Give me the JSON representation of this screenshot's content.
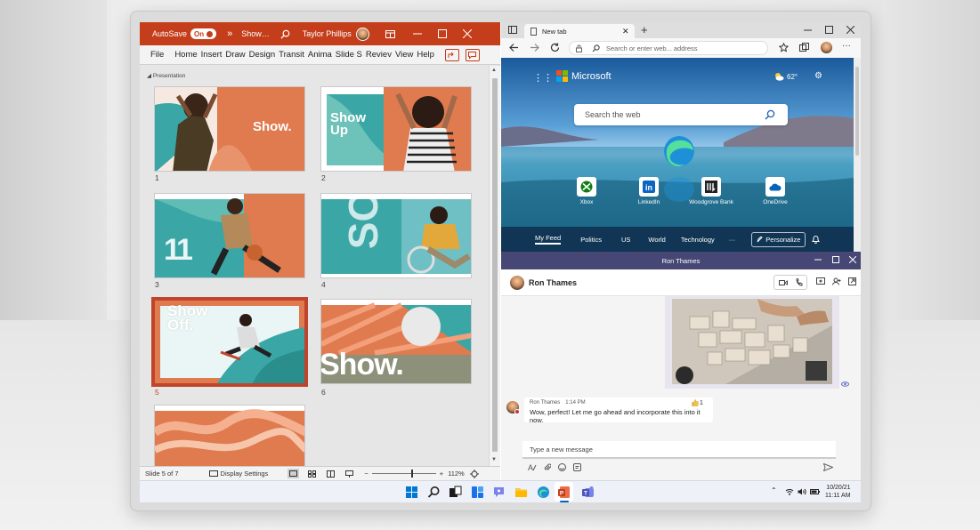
{
  "powerpoint": {
    "autosave_label": "AutoSave",
    "autosave_state": "On",
    "overflow": "»",
    "doc_title": "Show…",
    "user_name": "Taylor Phillips",
    "menu": [
      "File",
      "Home",
      "Insert",
      "Draw",
      "Design",
      "Transit",
      "Anima",
      "Slide S",
      "Reviev",
      "View",
      "Help"
    ],
    "section": "Presentation",
    "slides": [
      {
        "num": "1",
        "text": "Show."
      },
      {
        "num": "2",
        "text": "Show\nUp"
      },
      {
        "num": "3",
        "text": "11"
      },
      {
        "num": "4",
        "text": "SO"
      },
      {
        "num": "5",
        "text": "Show\nOff.",
        "selected": true
      },
      {
        "num": "6",
        "text": "Show."
      },
      {
        "num": "",
        "text": ""
      }
    ],
    "status": {
      "slide_info": "Slide 5 of 7",
      "display_settings": "Display Settings",
      "minus": "−",
      "plus": "+",
      "zoom": "112%"
    }
  },
  "edge": {
    "tab_title": "New tab",
    "new_tab": "+",
    "address_placeholder": "Search or enter web... address",
    "brand": "Microsoft",
    "weather": "62°",
    "search_placeholder": "Search the web",
    "quick_links": [
      "Xbox",
      "LinkedIn",
      "Woodgrove Bank",
      "OneDrive"
    ],
    "feed_tabs": [
      "My Feed",
      "Politics",
      "US",
      "World",
      "Technology"
    ],
    "more": "···",
    "personalize": "Personalize"
  },
  "teams": {
    "window_title": "Ron Thames",
    "contact": "Ron Thames",
    "message_sender": "Ron Thames",
    "message_time": "1:14 PM",
    "reaction": "1",
    "message_text": "Wow, perfect! Let me go ahead and incorporate this into it now.",
    "compose_placeholder": "Type a new message"
  },
  "taskbar": {
    "time": "11:11 AM",
    "date": "10/20/21"
  },
  "colors": {
    "powerpoint": "#c43e1c",
    "teams": "#464775",
    "selection": "#c0442b",
    "teal": "#3aa7a6",
    "orange": "#e07a4f"
  }
}
